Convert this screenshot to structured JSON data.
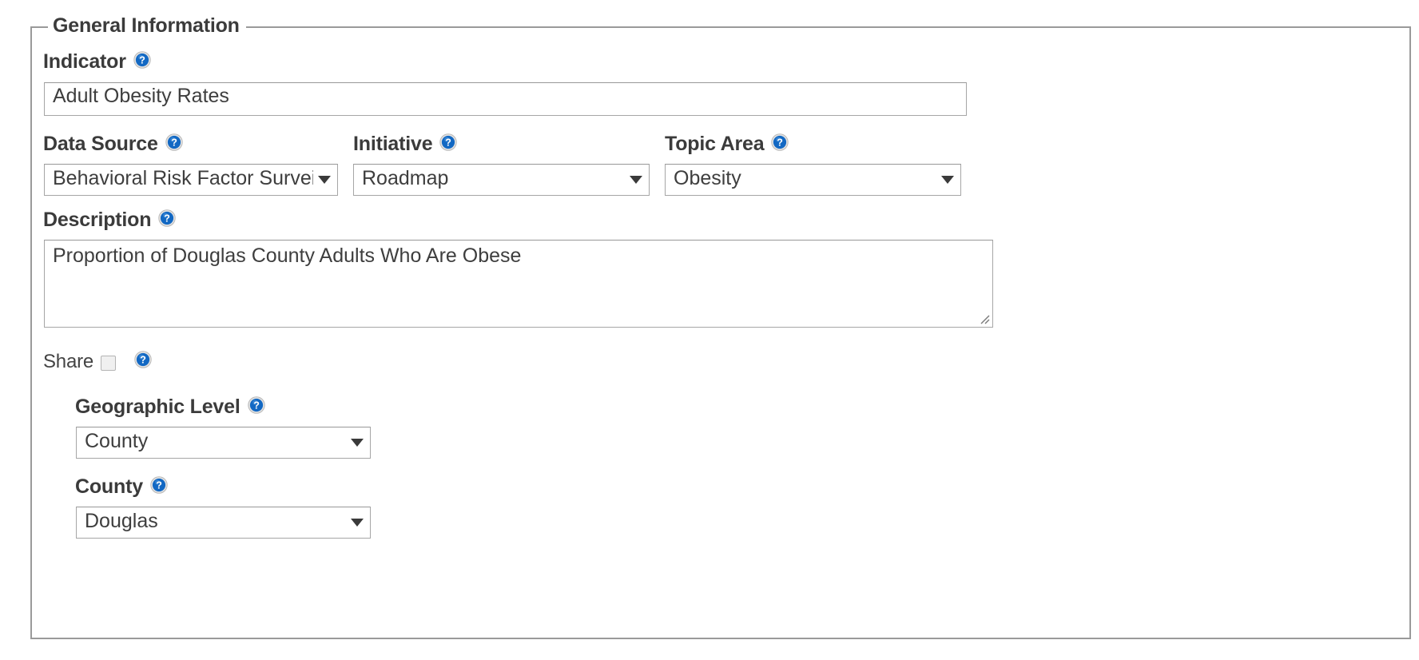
{
  "fieldset": {
    "legend": "General Information"
  },
  "indicator": {
    "label": "Indicator",
    "help_icon": "help-circle-icon",
    "value": "Adult Obesity Rates"
  },
  "data_source": {
    "label": "Data Source",
    "help_icon": "help-circle-icon",
    "value": "Behavioral Risk Factor Surveil"
  },
  "initiative": {
    "label": "Initiative",
    "help_icon": "help-circle-icon",
    "value": "Roadmap"
  },
  "topic_area": {
    "label": "Topic Area",
    "help_icon": "help-circle-icon",
    "value": "Obesity"
  },
  "description": {
    "label": "Description",
    "help_icon": "help-circle-icon",
    "value": "Proportion of Douglas County Adults Who Are Obese"
  },
  "share": {
    "label": "Share",
    "help_icon": "help-circle-icon",
    "checked": false
  },
  "geographic_level": {
    "label": "Geographic Level",
    "help_icon": "help-circle-icon",
    "value": "County"
  },
  "county": {
    "label": "County",
    "help_icon": "help-circle-icon",
    "value": "Douglas"
  },
  "colors": {
    "page_background": "#ffffff",
    "fieldset_border": "#9a9a9a",
    "label_text": "#3b3b3b",
    "input_text": "#3e3e3e",
    "input_border": "#a6a6a6",
    "help_icon_blue": "#1268c3",
    "help_icon_ring": "#dcdcdc"
  }
}
